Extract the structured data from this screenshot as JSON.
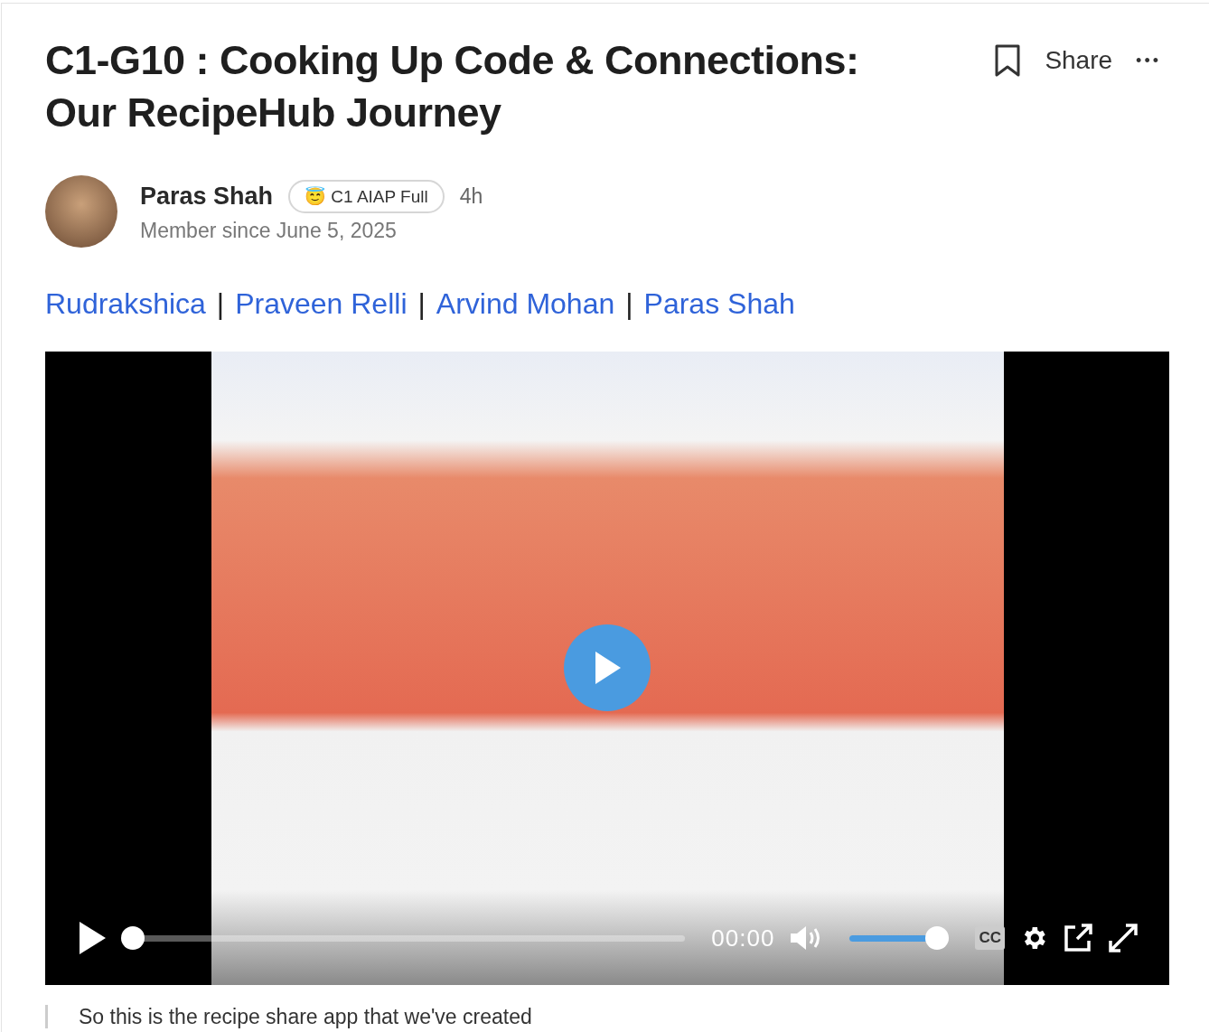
{
  "post": {
    "title": "C1-G10 : Cooking Up Code & Connections: Our RecipeHub Journey",
    "share": "Share",
    "more": "•••"
  },
  "author": {
    "name": "Paras Shah",
    "badge_emoji": "😇",
    "badge": "C1 AIAP Full",
    "time": "4h",
    "member_since": "Member since June 5, 2025"
  },
  "team": {
    "separator": "|",
    "members": [
      {
        "name": "Rudrakshica"
      },
      {
        "name": "Praveen Relli"
      },
      {
        "name": "Arvind Mohan"
      },
      {
        "name": "Paras Shah"
      }
    ]
  },
  "video": {
    "time": "00:00",
    "captions": "CC",
    "progress": {
      "level": 0
    },
    "volume": {
      "level": 0.88
    }
  },
  "quote": "So this is the recipe share app that we've created"
}
